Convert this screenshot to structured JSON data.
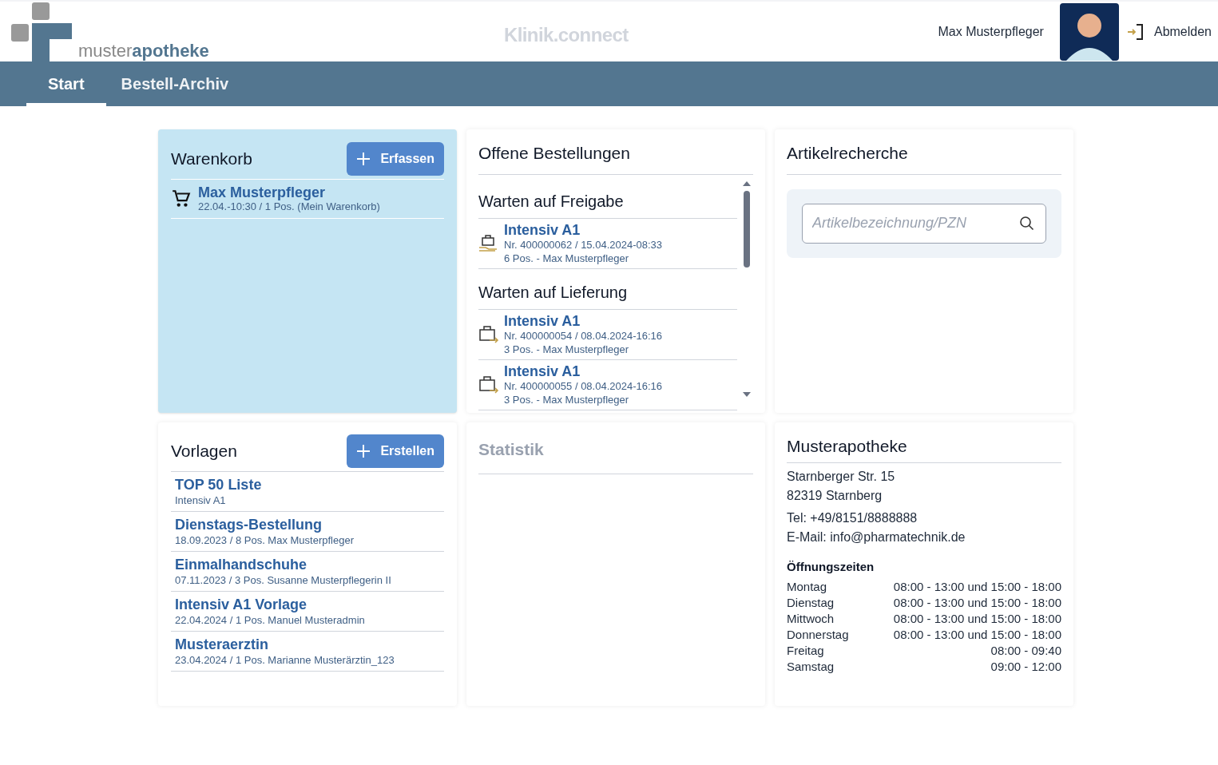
{
  "header": {
    "logo": {
      "light": "muster",
      "bold": "apotheke"
    },
    "app_title": "Klinik.connect",
    "user": "Max Musterpfleger",
    "logout": "Abmelden"
  },
  "tabs": [
    {
      "label": "Start",
      "selected": true
    },
    {
      "label": "Bestell-Archiv",
      "selected": false
    }
  ],
  "cart": {
    "title": "Warenkorb",
    "button": "Erfassen",
    "items": [
      {
        "name": "Max Musterpfleger",
        "detail": "22.04.-10:30 / 1 Pos. (Mein Warenkorb)"
      }
    ]
  },
  "open_orders": {
    "title": "Offene Bestellungen",
    "sections": [
      {
        "title": "Warten auf Freigabe",
        "kind": "approval",
        "orders": [
          {
            "name": "Intensiv A1",
            "number": "Nr. 400000062 / 15.04.2024-08:33",
            "detail": "6 Pos. - Max Musterpfleger"
          }
        ]
      },
      {
        "title": "Warten auf Lieferung",
        "kind": "delivery",
        "orders": [
          {
            "name": "Intensiv A1",
            "number": "Nr. 400000054 / 08.04.2024-16:16",
            "detail": "3 Pos. - Max Musterpfleger"
          },
          {
            "name": "Intensiv A1",
            "number": "Nr. 400000055 / 08.04.2024-16:16",
            "detail": "3 Pos. - Max Musterpfleger"
          }
        ]
      }
    ]
  },
  "article_search": {
    "title": "Artikelrecherche",
    "placeholder": "Artikelbezeichnung/PZN"
  },
  "templates": {
    "title": "Vorlagen",
    "button": "Erstellen",
    "items": [
      {
        "name": "TOP 50 Liste",
        "detail": "Intensiv A1"
      },
      {
        "name": "Dienstags-Bestellung",
        "detail": "18.09.2023 / 8 Pos. Max Musterpfleger"
      },
      {
        "name": "Einmalhandschuhe",
        "detail": "07.11.2023 / 3 Pos. Susanne Musterpflegerin II"
      },
      {
        "name": "Intensiv A1 Vorlage",
        "detail": "22.04.2024 / 1 Pos. Manuel Musteradmin"
      },
      {
        "name": "Musteraerztin",
        "detail": "23.04.2024 / 1 Pos. Marianne Musterärztin_123"
      }
    ]
  },
  "statistics": {
    "title": "Statistik",
    "disabled": true
  },
  "pharmacy": {
    "title": "Musterapotheke",
    "address": [
      "Starnberger Str. 15",
      "82319 Starnberg"
    ],
    "contact": [
      "Tel: +49/8151/8888888",
      "E-Mail: info@pharmatechnik.de"
    ],
    "hours_title": "Öffnungszeiten",
    "hours": [
      {
        "day": "Montag",
        "time": "08:00 - 13:00 und 15:00 - 18:00"
      },
      {
        "day": "Dienstag",
        "time": "08:00 - 13:00 und 15:00 - 18:00"
      },
      {
        "day": "Mittwoch",
        "time": "08:00 - 13:00 und 15:00 - 18:00"
      },
      {
        "day": "Donnerstag",
        "time": "08:00 - 13:00 und 15:00 - 18:00"
      },
      {
        "day": "Freitag",
        "time": "08:00 - 09:40"
      },
      {
        "day": "Samstag",
        "time": "09:00 - 12:00"
      }
    ]
  }
}
